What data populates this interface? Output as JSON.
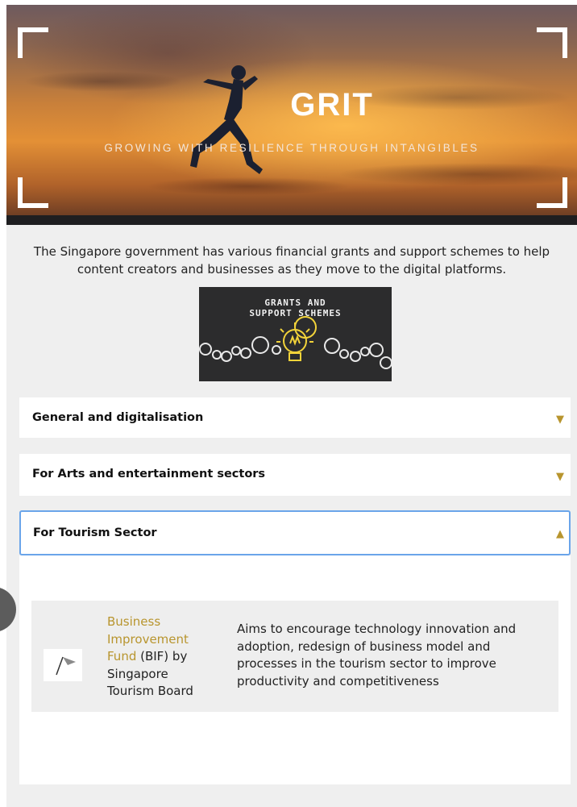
{
  "hero": {
    "title": "GRIT",
    "subtitle": "GROWING WITH RESILIENCE THROUGH INTANGIBLES"
  },
  "intro": {
    "text": "The Singapore government has various financial grants and support schemes to help content creators and businesses as they move to the digital platforms."
  },
  "grants_image": {
    "line1": "GRANTS AND",
    "line2": "SUPPORT SCHEMES",
    "icon": "lightbulb-gears-icon",
    "accent": "#f2d33a"
  },
  "accordion": [
    {
      "title": "General and digitalisation",
      "arrow": "▼",
      "state": "collapsed"
    },
    {
      "title": "For Arts and entertainment sectors",
      "arrow": "▼",
      "state": "collapsed"
    },
    {
      "title": "For Tourism Sector",
      "arrow": "▲",
      "state": "expanded"
    }
  ],
  "tourism": {
    "scheme": {
      "link_text": "Business Improvement Fund",
      "suffix": " (BIF) by Singapore Tourism Board",
      "description": "Aims to encourage technology innovation and adoption, redesign of business model and processes in the tourism sector to improve productivity and competitiveness",
      "logo_icon": "flag-icon"
    }
  },
  "colors": {
    "accent_gold": "#b8952e",
    "focus_blue": "#6aa5ea",
    "page_bg": "#efefef"
  }
}
